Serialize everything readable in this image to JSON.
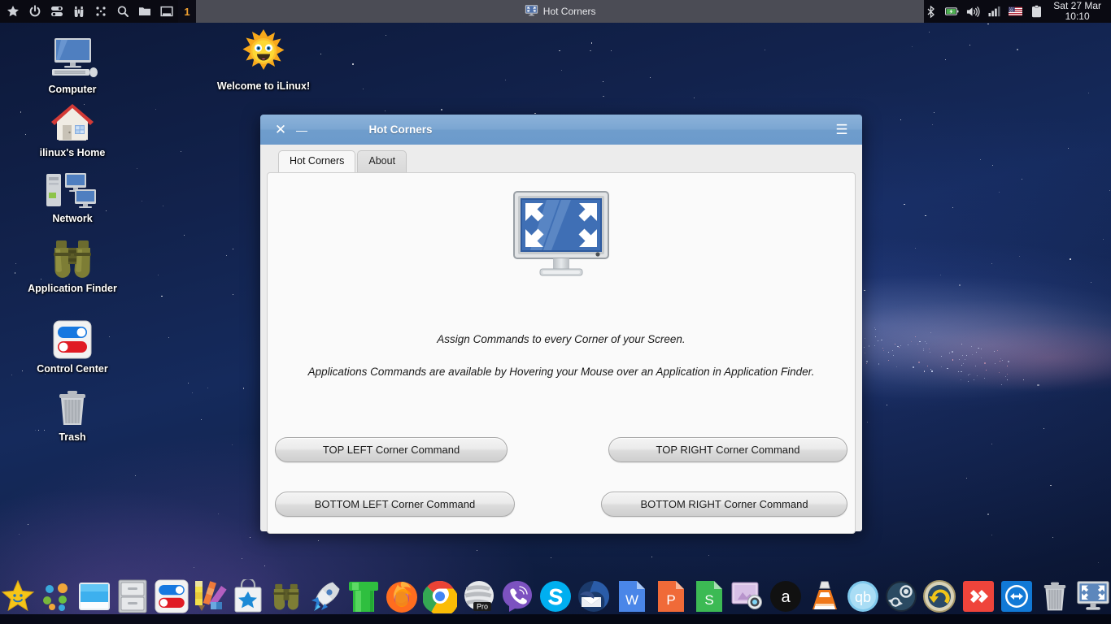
{
  "panel": {
    "left_icons": [
      {
        "name": "star-icon",
        "title": "Favorites"
      },
      {
        "name": "power-icon",
        "title": "Power"
      },
      {
        "name": "settings-toggle-icon",
        "title": "Settings"
      },
      {
        "name": "binoculars-icon",
        "title": "Application Finder"
      },
      {
        "name": "grid-dots-icon",
        "title": "Applications"
      },
      {
        "name": "search-icon",
        "title": "Search"
      },
      {
        "name": "folder-icon",
        "title": "File Manager"
      },
      {
        "name": "window-icon",
        "title": "Show Desktop"
      }
    ],
    "workspace": "1",
    "task": {
      "label": "Hot Corners",
      "icon": "monitor-hotcorners-icon"
    },
    "tray": [
      {
        "name": "bluetooth-icon"
      },
      {
        "name": "battery-charging-icon"
      },
      {
        "name": "volume-icon"
      },
      {
        "name": "network-signal-icon"
      },
      {
        "name": "keyboard-layout-us-flag-icon"
      },
      {
        "name": "clipboard-icon"
      }
    ],
    "clock_date": "Sat 27 Mar",
    "clock_time": "10:10"
  },
  "desktop": {
    "icons": [
      {
        "label": "Computer",
        "icon": "computer-icon"
      },
      {
        "label": "ilinux's Home",
        "icon": "home-folder-icon"
      },
      {
        "label": "Network",
        "icon": "network-icon"
      },
      {
        "label": "Application Finder",
        "icon": "binoculars-icon"
      },
      {
        "label": "Control Center",
        "icon": "control-center-icon"
      },
      {
        "label": "Trash",
        "icon": "trash-icon"
      },
      {
        "label": "Welcome to iLinux!",
        "icon": "sun-smiley-icon"
      }
    ]
  },
  "window": {
    "title": "Hot Corners",
    "close_label": "✕",
    "minimize_label": "—",
    "menu_label": "☰",
    "tabs": [
      {
        "label": "Hot Corners",
        "active": true
      },
      {
        "label": "About",
        "active": false
      }
    ],
    "hero_icon": "hot-corners-monitor-icon",
    "description_1": "Assign Commands to every Corner of your Screen.",
    "description_2": "Applications Commands are available by Hovering your Mouse over an Application in Application Finder.",
    "buttons": {
      "top_left": "TOP LEFT Corner Command",
      "top_right": "TOP RIGHT Corner Command",
      "bottom_left": "BOTTOM LEFT Corner Command",
      "bottom_right": "BOTTOM RIGHT Corner Command"
    },
    "accent_color": "#7ba6d2"
  },
  "dock": {
    "items": [
      {
        "name": "star-launcher-icon",
        "label": "Whisker Menu"
      },
      {
        "name": "app-dots-icon",
        "label": "Applications"
      },
      {
        "name": "file-manager-icon",
        "label": "File Manager"
      },
      {
        "name": "archive-cabinet-icon",
        "label": "Archive Manager"
      },
      {
        "name": "control-center-icon",
        "label": "Control Center"
      },
      {
        "name": "theme-colors-icon",
        "label": "Appearance"
      },
      {
        "name": "software-store-icon",
        "label": "Software Store"
      },
      {
        "name": "binoculars-icon",
        "label": "Application Finder"
      },
      {
        "name": "rocket-icon",
        "label": "Launcher"
      },
      {
        "name": "green-pipe-icon",
        "label": "Pipe"
      },
      {
        "name": "firefox-icon",
        "label": "Firefox"
      },
      {
        "name": "chrome-icon",
        "label": "Google Chrome"
      },
      {
        "name": "opera-pro-icon",
        "label": "Opera"
      },
      {
        "name": "viber-icon",
        "label": "Viber"
      },
      {
        "name": "skype-icon",
        "label": "Skype"
      },
      {
        "name": "thunderbird-icon",
        "label": "Thunderbird"
      },
      {
        "name": "writer-doc-icon",
        "label": "Writer"
      },
      {
        "name": "presentation-icon",
        "label": "Impress"
      },
      {
        "name": "spreadsheet-icon",
        "label": "Calc"
      },
      {
        "name": "screenshot-icon",
        "label": "Screenshot"
      },
      {
        "name": "amazon-icon",
        "label": "Amazon"
      },
      {
        "name": "vlc-icon",
        "label": "VLC Media Player"
      },
      {
        "name": "qbittorrent-icon",
        "label": "qBittorrent"
      },
      {
        "name": "steam-icon",
        "label": "Steam"
      },
      {
        "name": "undo-restore-icon",
        "label": "Backup"
      },
      {
        "name": "anydesk-icon",
        "label": "AnyDesk"
      },
      {
        "name": "teamviewer-icon",
        "label": "TeamViewer"
      },
      {
        "name": "trash-icon",
        "label": "Trash"
      },
      {
        "name": "hot-corners-monitor-icon",
        "label": "Hot Corners"
      }
    ]
  }
}
